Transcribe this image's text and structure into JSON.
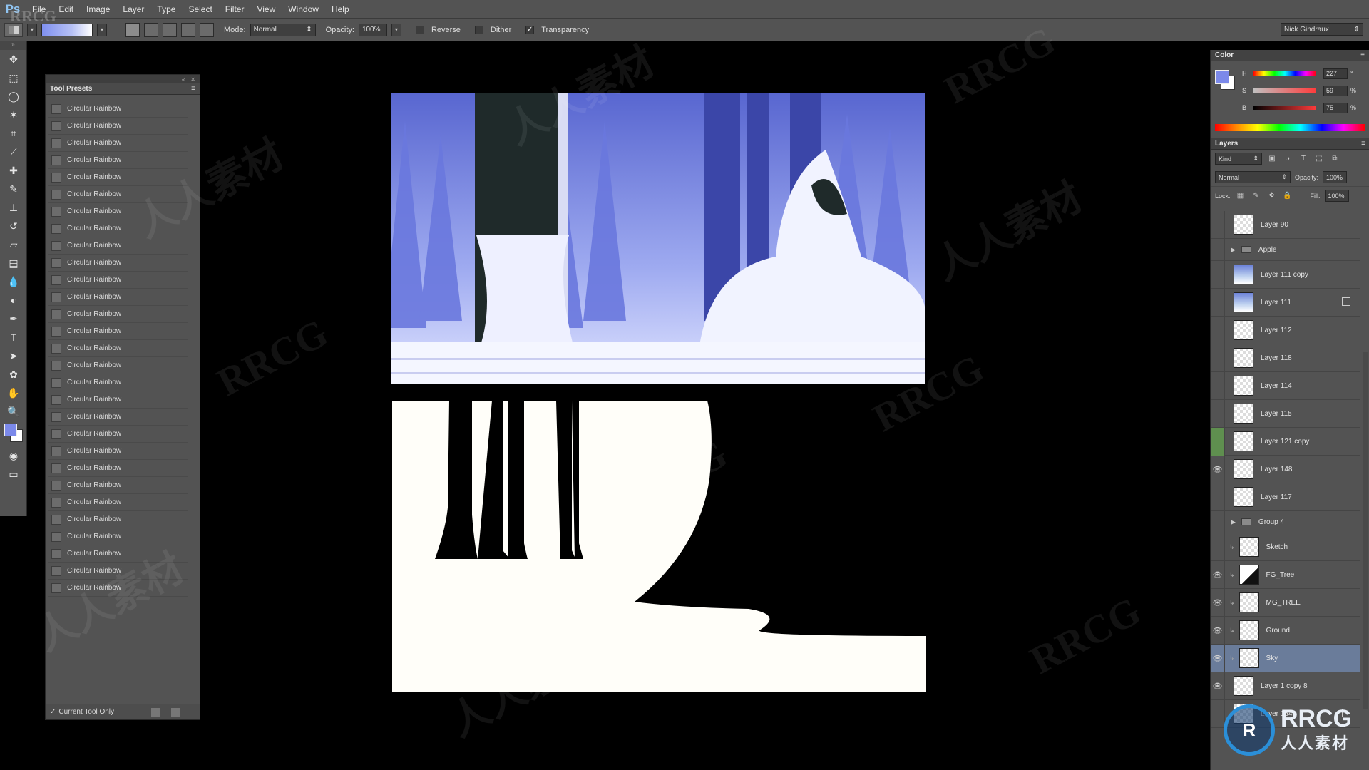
{
  "app": {
    "logo": "Ps"
  },
  "menu": [
    "File",
    "Edit",
    "Image",
    "Layer",
    "Type",
    "Select",
    "Filter",
    "View",
    "Window",
    "Help"
  ],
  "options": {
    "mode_label": "Mode:",
    "mode_value": "Normal",
    "opacity_label": "Opacity:",
    "opacity_value": "100%",
    "reverse_label": "Reverse",
    "dither_label": "Dither",
    "transparency_label": "Transparency",
    "transparency_checked": "✓",
    "workspace_value": "Nick Gindraux"
  },
  "tool_presets": {
    "title": "Tool Presets",
    "items": [
      "Circular Rainbow",
      "Circular Rainbow",
      "Circular Rainbow",
      "Circular Rainbow",
      "Circular Rainbow",
      "Circular Rainbow",
      "Circular Rainbow",
      "Circular Rainbow",
      "Circular Rainbow",
      "Circular Rainbow",
      "Circular Rainbow",
      "Circular Rainbow",
      "Circular Rainbow",
      "Circular Rainbow",
      "Circular Rainbow",
      "Circular Rainbow",
      "Circular Rainbow",
      "Circular Rainbow",
      "Circular Rainbow",
      "Circular Rainbow",
      "Circular Rainbow",
      "Circular Rainbow",
      "Circular Rainbow",
      "Circular Rainbow",
      "Circular Rainbow",
      "Circular Rainbow",
      "Circular Rainbow",
      "Circular Rainbow",
      "Circular Rainbow"
    ],
    "footer_check": "✓",
    "footer_label": "Current Tool Only"
  },
  "color_panel": {
    "title": "Color",
    "h_label": "H",
    "h_value": "227",
    "h_unit": "°",
    "s_label": "S",
    "s_value": "59",
    "s_unit": "%",
    "b_label": "B",
    "b_value": "75",
    "b_unit": "%",
    "foreground": "#7b89ea",
    "background": "#ffffff"
  },
  "layers_panel": {
    "title": "Layers",
    "kind_label": "Kind",
    "blend_mode": "Normal",
    "opacity_label": "Opacity:",
    "opacity_value": "100%",
    "lock_label": "Lock:",
    "fill_label": "Fill:",
    "fill_value": "100%",
    "layers": [
      {
        "name": "Layer 90",
        "thumb": "checker",
        "eye": "",
        "kind": "layer"
      },
      {
        "name": "Apple",
        "thumb": "folder",
        "eye": "",
        "kind": "group"
      },
      {
        "name": "Layer 111 copy",
        "thumb": "blue",
        "eye": "",
        "kind": "layer"
      },
      {
        "name": "Layer 111",
        "thumb": "blue",
        "eye": "",
        "kind": "layer",
        "badge": true
      },
      {
        "name": "Layer 112",
        "thumb": "checker",
        "eye": "",
        "kind": "layer"
      },
      {
        "name": "Layer 118",
        "thumb": "checker",
        "eye": "",
        "kind": "layer"
      },
      {
        "name": "Layer 114",
        "thumb": "checker",
        "eye": "",
        "kind": "layer"
      },
      {
        "name": "Layer 115",
        "thumb": "checker",
        "eye": "",
        "kind": "layer"
      },
      {
        "name": "Layer 121 copy",
        "thumb": "checker",
        "eye": "",
        "kind": "layer",
        "green": true
      },
      {
        "name": "Layer 148",
        "thumb": "checker",
        "eye": "👁",
        "kind": "layer"
      },
      {
        "name": "Layer 117",
        "thumb": "checker",
        "eye": "",
        "kind": "layer"
      },
      {
        "name": "Group 4",
        "thumb": "folder",
        "eye": "",
        "kind": "group"
      },
      {
        "name": "Sketch",
        "thumb": "checker",
        "eye": "",
        "kind": "clip"
      },
      {
        "name": "FG_Tree",
        "thumb": "fgtree",
        "eye": "👁",
        "kind": "clip"
      },
      {
        "name": "MG_TREE",
        "thumb": "checker",
        "eye": "👁",
        "kind": "clip"
      },
      {
        "name": "Ground",
        "thumb": "checker",
        "eye": "👁",
        "kind": "clip"
      },
      {
        "name": "Sky",
        "thumb": "checker",
        "eye": "👁",
        "kind": "clip",
        "selected": true
      },
      {
        "name": "Layer 1 copy 8",
        "thumb": "checker",
        "eye": "👁",
        "kind": "layer"
      },
      {
        "name": "Layer 154",
        "thumb": "checker",
        "eye": "",
        "kind": "layer",
        "badge": true
      }
    ]
  },
  "watermarks": {
    "rrcg": "RRCG",
    "cn": "人人素材",
    "logo_top": "RRCG",
    "logo_bottom": "人人素材"
  }
}
